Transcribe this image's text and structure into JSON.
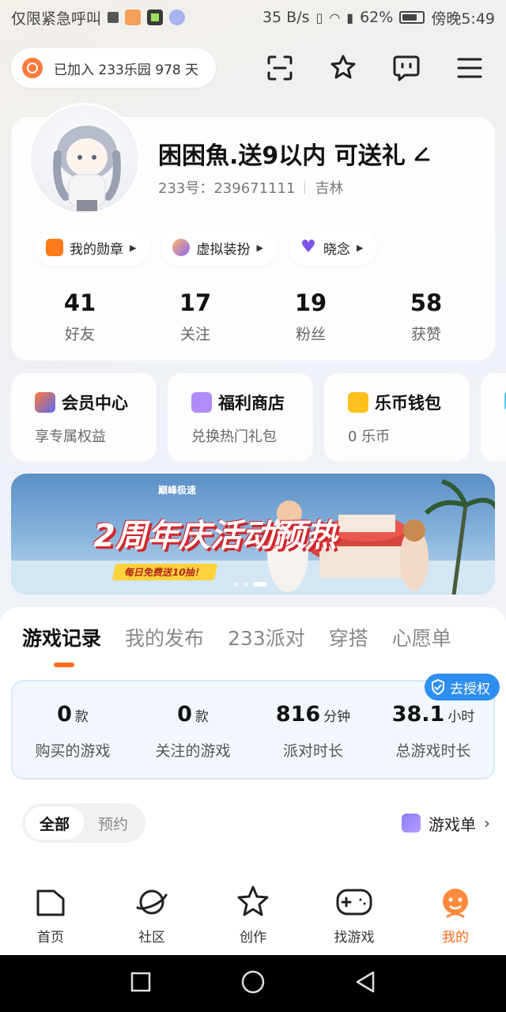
{
  "status_bar": {
    "carrier_text": "仅限紧急呼叫",
    "network_speed": "35 B/s",
    "battery": "62%",
    "time": "傍晚5:49"
  },
  "header": {
    "join_text": "已加入 233乐园 978 天",
    "icons": [
      "scan-icon",
      "star-sparkle-icon",
      "message-icon",
      "menu-icon"
    ]
  },
  "profile": {
    "nickname": "困困魚.送9以内 可送礼",
    "uid_label": "233号：239671111",
    "location": "吉林",
    "chips": [
      {
        "label": "我的勋章",
        "color": "#ff7a1a"
      },
      {
        "label": "虚拟装扮",
        "color": "#8f6bf3"
      },
      {
        "label": "晓念",
        "color": "#7a55e8"
      }
    ],
    "stats": [
      {
        "value": "41",
        "label": "好友"
      },
      {
        "value": "17",
        "label": "关注"
      },
      {
        "value": "19",
        "label": "粉丝"
      },
      {
        "value": "58",
        "label": "获赞"
      }
    ]
  },
  "services": [
    {
      "title": "会员中心",
      "subtitle": "享专属权益",
      "color": "#5b6cf0"
    },
    {
      "title": "福利商店",
      "subtitle": "兑换热门礼包",
      "color": "#b08cf7"
    },
    {
      "title": "乐币钱包",
      "subtitle": "0 乐币",
      "color": "#ffbf1f"
    },
    {
      "title": "",
      "subtitle": "",
      "color": "#4fc3f7"
    }
  ],
  "banner": {
    "brand": "巅峰极速",
    "headline": "2周年庆活动预热",
    "subline": "每日免费送10抽！"
  },
  "tabs": [
    "游戏记录",
    "我的发布",
    "233派对",
    "穿搭",
    "心愿单"
  ],
  "auth_badge": "去授权",
  "records": [
    {
      "value": "0",
      "unit": "款",
      "label": "购买的游戏"
    },
    {
      "value": "0",
      "unit": "款",
      "label": "关注的游戏"
    },
    {
      "value": "816",
      "unit": "分钟",
      "label": "派对时长"
    },
    {
      "value": "38.1",
      "unit": "小时",
      "label": "总游戏时长"
    }
  ],
  "filter": {
    "options": [
      "全部",
      "预约"
    ],
    "gamelist_label": "游戏单"
  },
  "bottom_nav": [
    {
      "label": "首页",
      "icon": "home-icon"
    },
    {
      "label": "社区",
      "icon": "planet-icon"
    },
    {
      "label": "创作",
      "icon": "star-icon"
    },
    {
      "label": "找游戏",
      "icon": "gamepad-icon"
    },
    {
      "label": "我的",
      "icon": "profile-face-icon"
    }
  ]
}
